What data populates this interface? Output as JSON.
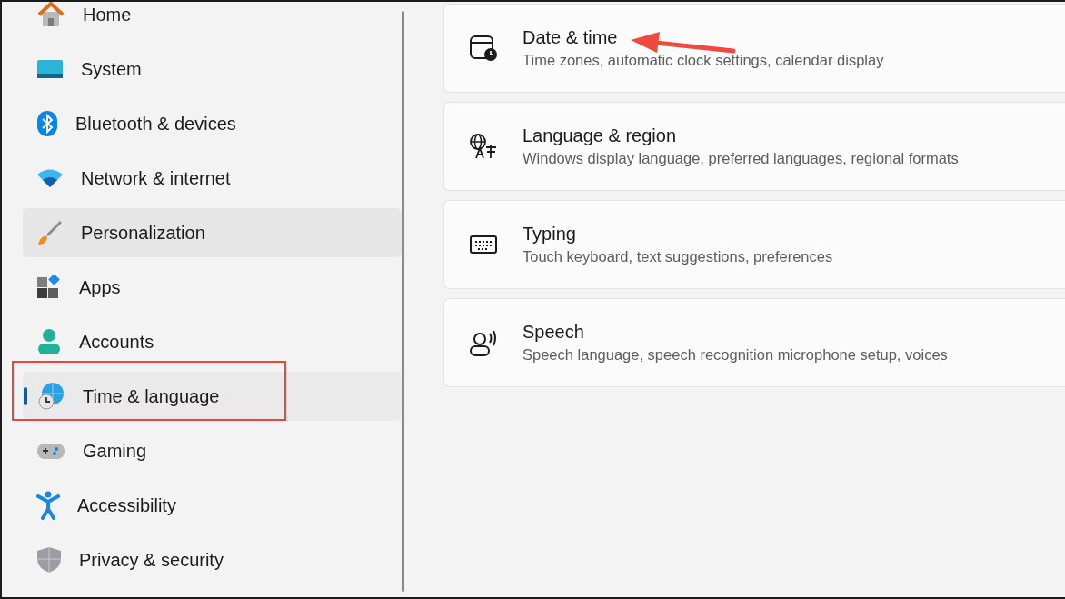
{
  "sidebar": {
    "items": [
      {
        "label": "Home",
        "selected": false,
        "hovered": false
      },
      {
        "label": "System",
        "selected": false,
        "hovered": false
      },
      {
        "label": "Bluetooth & devices",
        "selected": false,
        "hovered": false
      },
      {
        "label": "Network & internet",
        "selected": false,
        "hovered": false
      },
      {
        "label": "Personalization",
        "selected": false,
        "hovered": true
      },
      {
        "label": "Apps",
        "selected": false,
        "hovered": false
      },
      {
        "label": "Accounts",
        "selected": false,
        "hovered": false
      },
      {
        "label": "Time & language",
        "selected": true,
        "hovered": false
      },
      {
        "label": "Gaming",
        "selected": false,
        "hovered": false
      },
      {
        "label": "Accessibility",
        "selected": false,
        "hovered": false
      },
      {
        "label": "Privacy & security",
        "selected": false,
        "hovered": false
      }
    ]
  },
  "settings": [
    {
      "title": "Date & time",
      "description": "Time zones, automatic clock settings, calendar display"
    },
    {
      "title": "Language & region",
      "description": "Windows display language, preferred languages, regional formats"
    },
    {
      "title": "Typing",
      "description": "Touch keyboard, text suggestions, preferences"
    },
    {
      "title": "Speech",
      "description": "Speech language, speech recognition microphone setup, voices"
    }
  ],
  "annotations": {
    "highlight_box": true,
    "arrow": true
  }
}
